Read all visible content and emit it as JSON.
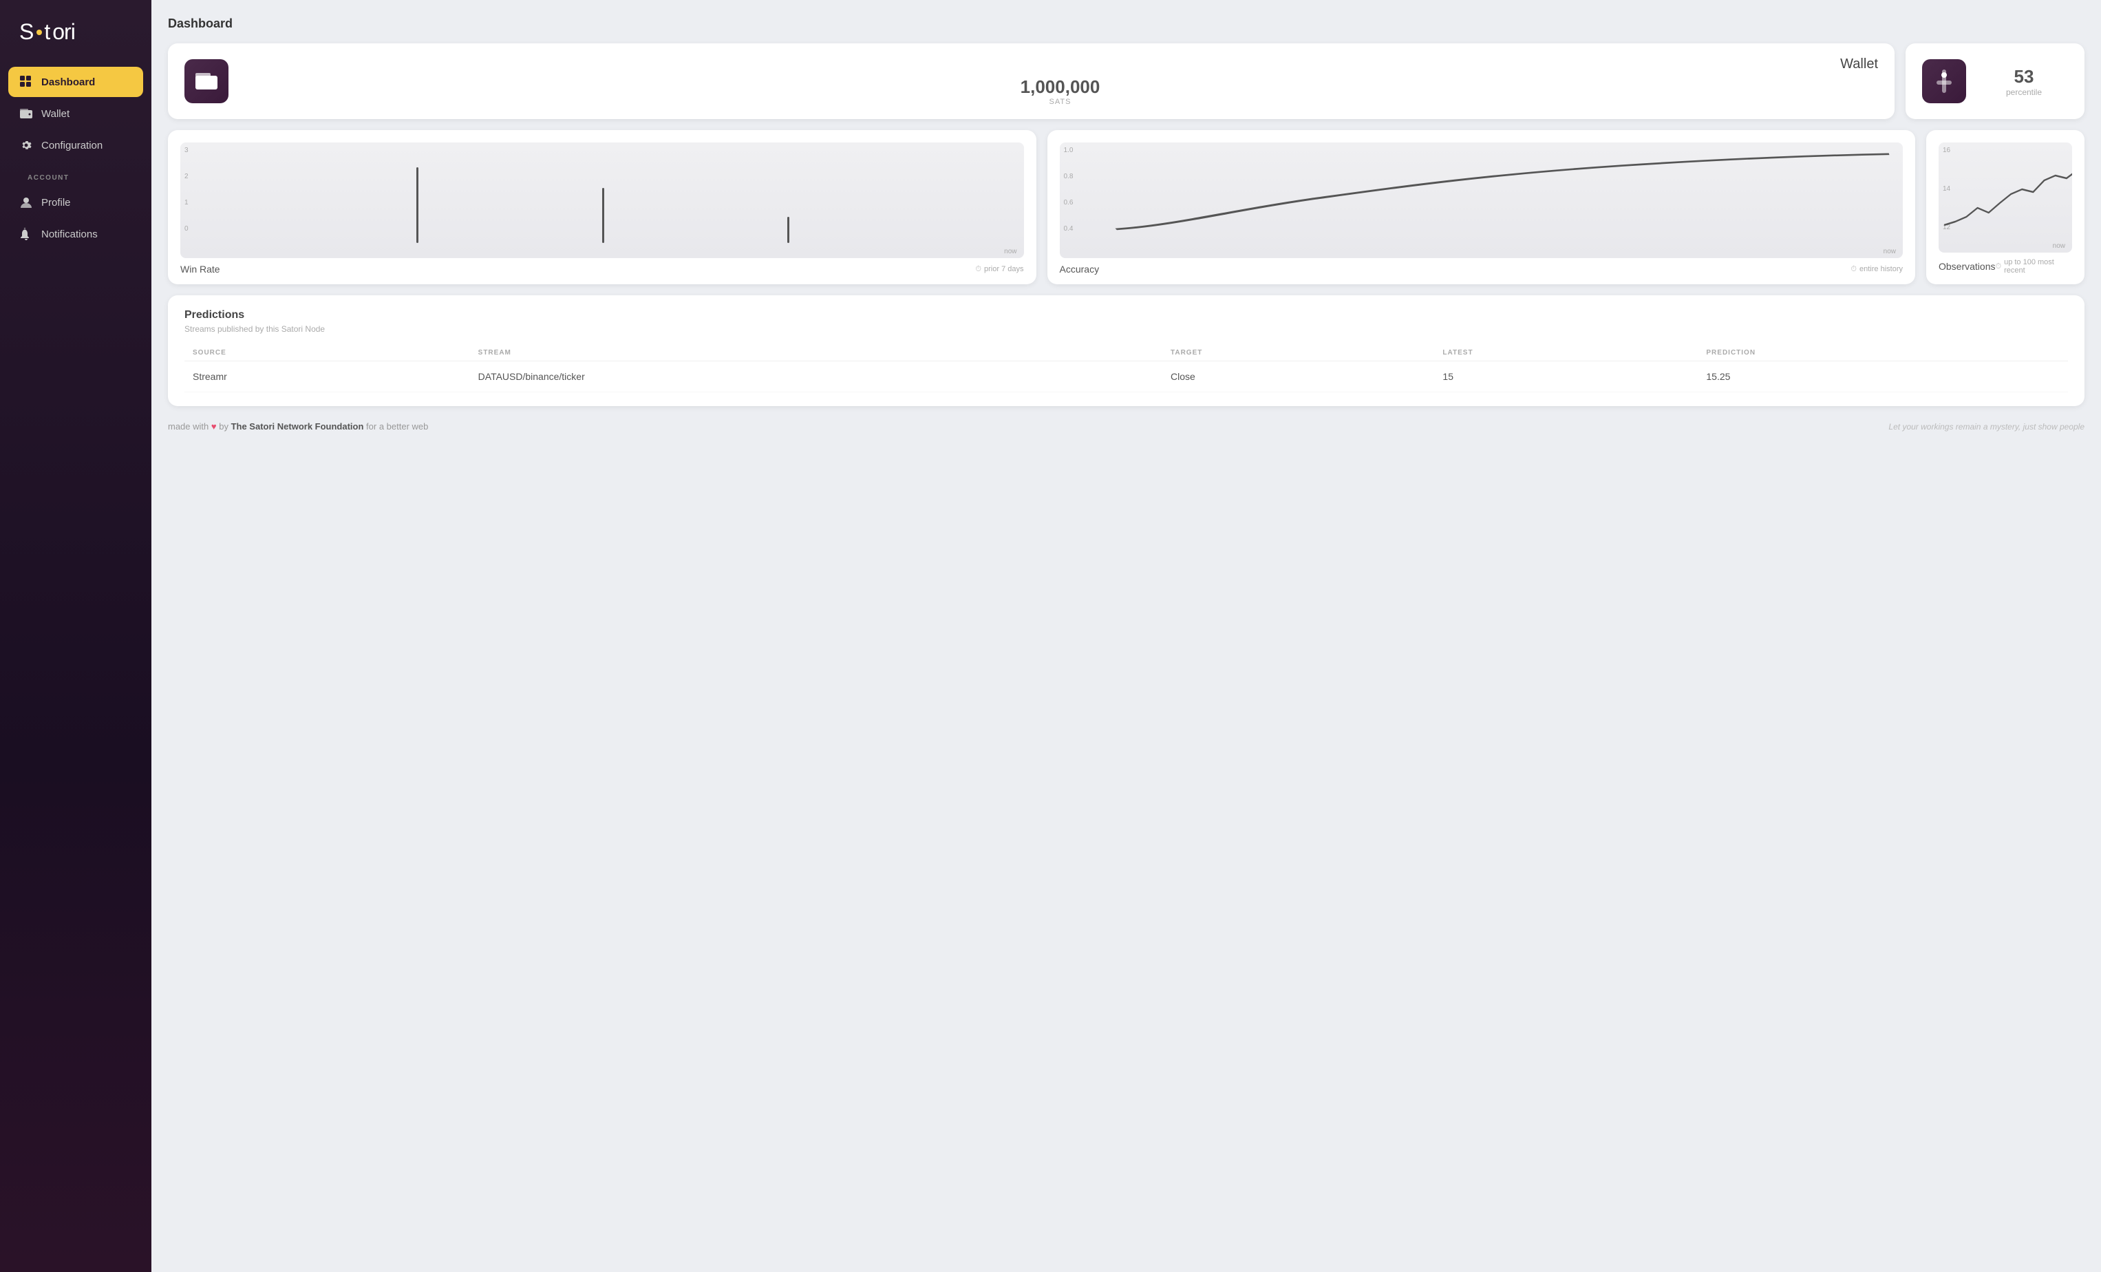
{
  "sidebar": {
    "logo_text": "Satori",
    "nav_items": [
      {
        "id": "dashboard",
        "label": "Dashboard",
        "icon": "⊞",
        "active": true
      },
      {
        "id": "wallet",
        "label": "Wallet",
        "icon": "▤"
      },
      {
        "id": "configuration",
        "label": "Configuration",
        "icon": "⚙"
      }
    ],
    "account_label": "ACCOUNT",
    "account_items": [
      {
        "id": "profile",
        "label": "Profile",
        "icon": "👤"
      },
      {
        "id": "notifications",
        "label": "Notifications",
        "icon": "🔔"
      }
    ]
  },
  "page": {
    "title": "Dashboard"
  },
  "wallet_card": {
    "title": "Wallet",
    "amount": "1,000,000",
    "unit": "SATS"
  },
  "percentile_card": {
    "value": "53",
    "label": "percentile"
  },
  "win_rate": {
    "title": "Win Rate",
    "time_label": "prior 7 days",
    "y_labels": [
      "3",
      "2",
      "1",
      "0"
    ],
    "x_label": "now"
  },
  "accuracy": {
    "title": "Accuracy",
    "time_label": "entire history",
    "y_labels": [
      "1.0",
      "0.8",
      "0.6",
      "0.4"
    ],
    "x_label": "now"
  },
  "observations": {
    "title": "Observations",
    "time_label": "up to 100 most recent",
    "y_labels": [
      "16",
      "14",
      "12"
    ],
    "x_label": "now"
  },
  "predictions": {
    "title": "Predictions",
    "subtitle": "Streams published by this Satori Node",
    "columns": [
      "SOURCE",
      "STREAM",
      "TARGET",
      "LATEST",
      "PREDICTION"
    ],
    "rows": [
      {
        "source": "Streamr",
        "stream": "DATAUSD/binance/ticker",
        "target": "Close",
        "latest": "15",
        "prediction": "15.25"
      }
    ]
  },
  "footer": {
    "made_with": "made with",
    "by_text": "by",
    "org_name": "The Satori Network Foundation",
    "for_text": "for a better web",
    "tagline": "Let your workings remain a mystery, just show people"
  }
}
